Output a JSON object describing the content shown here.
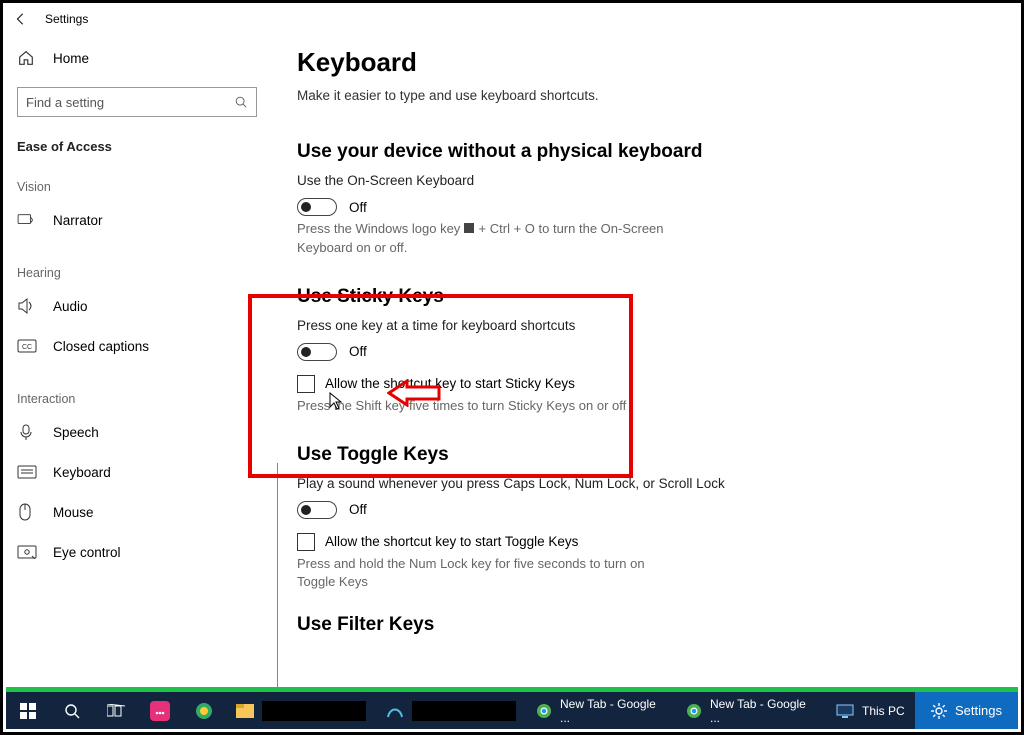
{
  "titlebar": {
    "title": "Settings"
  },
  "sidebar": {
    "home": "Home",
    "search_placeholder": "Find a setting",
    "section": "Ease of Access",
    "groups": {
      "vision": {
        "label": "Vision",
        "items": [
          {
            "icon": "narrator",
            "label": "Narrator"
          }
        ]
      },
      "hearing": {
        "label": "Hearing",
        "items": [
          {
            "icon": "audio",
            "label": "Audio"
          },
          {
            "icon": "captions",
            "label": "Closed captions"
          }
        ]
      },
      "interaction": {
        "label": "Interaction",
        "items": [
          {
            "icon": "speech",
            "label": "Speech"
          },
          {
            "icon": "keyboard",
            "label": "Keyboard"
          },
          {
            "icon": "mouse",
            "label": "Mouse"
          },
          {
            "icon": "eye",
            "label": "Eye control"
          }
        ]
      }
    }
  },
  "main": {
    "title": "Keyboard",
    "subtitle": "Make it easier to type and use keyboard shortcuts.",
    "s1": {
      "heading": "Use your device without a physical keyboard",
      "line": "Use the On-Screen Keyboard",
      "toggle_state": "Off",
      "hint_a": "Press the Windows logo key",
      "hint_b": "+ Ctrl + O to turn the On-Screen Keyboard on or off."
    },
    "s2": {
      "heading": "Use Sticky Keys",
      "line": "Press one key at a time for keyboard shortcuts",
      "toggle_state": "Off",
      "cb_label": "Allow the shortcut key to start Sticky Keys",
      "hint": "Press the Shift key five times to turn Sticky Keys on or off"
    },
    "s3": {
      "heading": "Use Toggle Keys",
      "line": "Play a sound whenever you press Caps Lock, Num Lock, or Scroll Lock",
      "toggle_state": "Off",
      "cb_label": "Allow the shortcut key to start Toggle Keys",
      "hint": "Press and hold the Num Lock key for five seconds to turn on Toggle Keys"
    },
    "s4": {
      "heading": "Use Filter Keys"
    }
  },
  "taskbar": {
    "items": [
      {
        "name": "chrome1",
        "label": "New Tab - Google ..."
      },
      {
        "name": "chrome2",
        "label": "New Tab - Google ..."
      },
      {
        "name": "thispc",
        "label": "This PC"
      }
    ],
    "settings": "Settings"
  }
}
